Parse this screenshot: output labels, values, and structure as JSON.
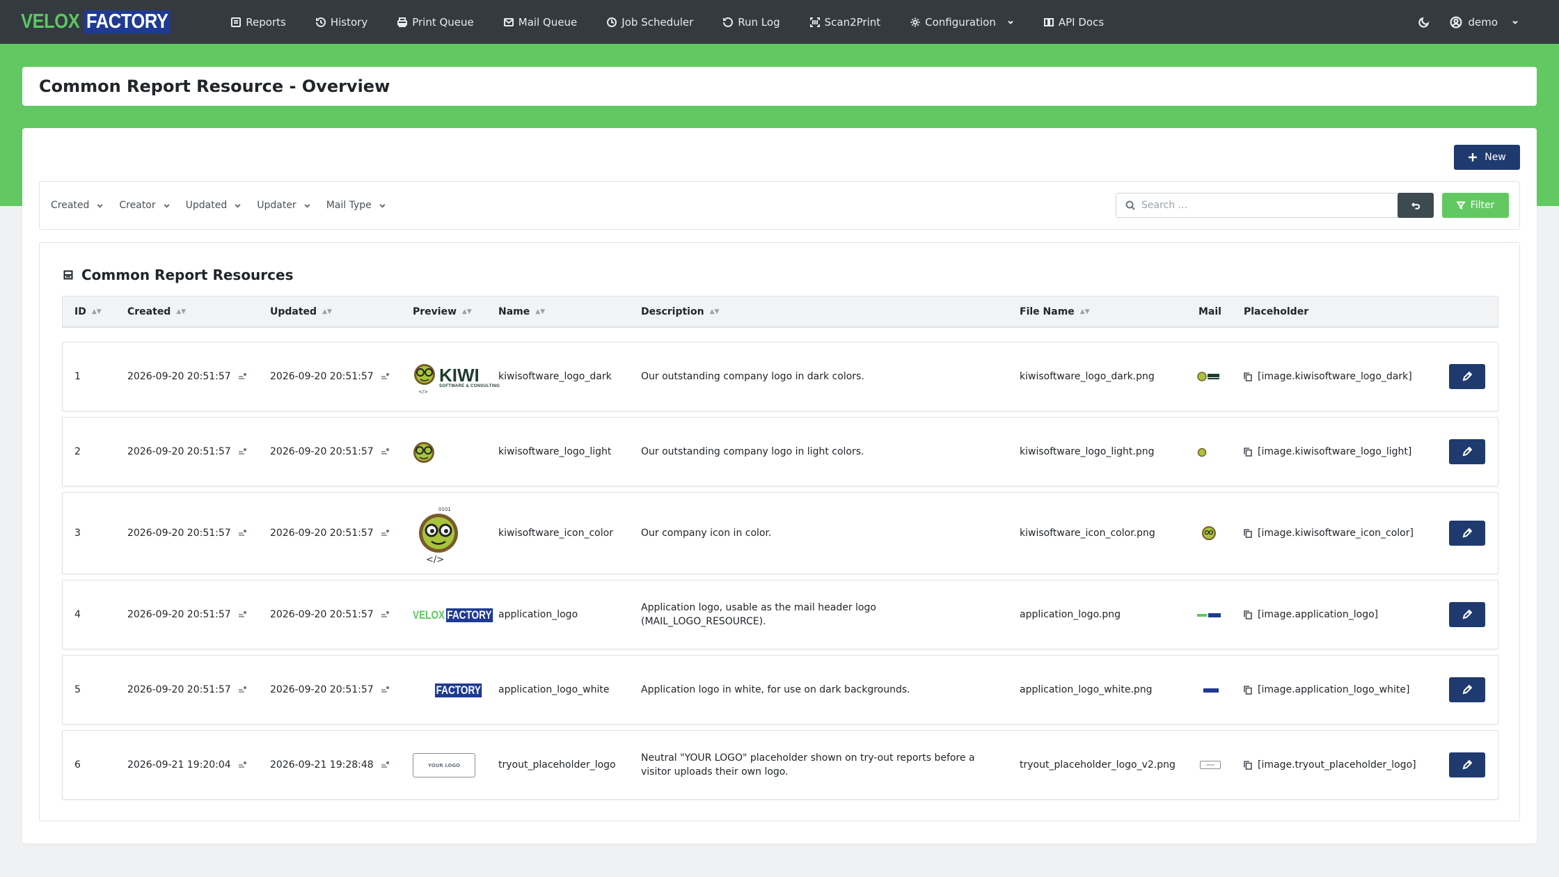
{
  "brand": {
    "part_a": "VELOX",
    "part_b": "FACTORY"
  },
  "nav": [
    {
      "label": "Reports",
      "icon": "reports-icon"
    },
    {
      "label": "History",
      "icon": "history-icon"
    },
    {
      "label": "Print Queue",
      "icon": "printer-icon"
    },
    {
      "label": "Mail Queue",
      "icon": "mail-icon"
    },
    {
      "label": "Job Scheduler",
      "icon": "clock-icon"
    },
    {
      "label": "Run Log",
      "icon": "run-log-icon"
    },
    {
      "label": "Scan2Print",
      "icon": "scan-icon"
    },
    {
      "label": "Configuration",
      "icon": "gear-icon"
    },
    {
      "label": "API Docs",
      "icon": "book-icon"
    }
  ],
  "user": {
    "name": "demo"
  },
  "page_title": "Common Report Resource - Overview",
  "toolbar": {
    "new_label": "New",
    "filter_label": "Filter"
  },
  "filters": [
    "Created",
    "Creator",
    "Updated",
    "Updater",
    "Mail Type"
  ],
  "search": {
    "placeholder": "Search ..."
  },
  "table": {
    "title": "Common Report Resources",
    "columns": [
      "ID",
      "Created",
      "Updated",
      "Preview",
      "Name",
      "Description",
      "File Name",
      "Mail",
      "Placeholder"
    ],
    "rows": [
      {
        "id": "1",
        "created": "2026-09-20 20:51:57",
        "updated": "2026-09-20 20:51:57",
        "name": "kiwisoftware_logo_dark",
        "description": "Our outstanding company logo in dark colors.",
        "file": "kiwisoftware_logo_dark.png",
        "placeholder": "[image.kiwisoftware_logo_dark]"
      },
      {
        "id": "2",
        "created": "2026-09-20 20:51:57",
        "updated": "2026-09-20 20:51:57",
        "name": "kiwisoftware_logo_light",
        "description": "Our outstanding company logo in light colors.",
        "file": "kiwisoftware_logo_light.png",
        "placeholder": "[image.kiwisoftware_logo_light]"
      },
      {
        "id": "3",
        "created": "2026-09-20 20:51:57",
        "updated": "2026-09-20 20:51:57",
        "name": "kiwisoftware_icon_color",
        "description": "Our company icon in color.",
        "file": "kiwisoftware_icon_color.png",
        "placeholder": "[image.kiwisoftware_icon_color]"
      },
      {
        "id": "4",
        "created": "2026-09-20 20:51:57",
        "updated": "2026-09-20 20:51:57",
        "name": "application_logo",
        "description": "Application logo, usable as the mail header logo (MAIL_LOGO_RESOURCE).",
        "file": "application_logo.png",
        "placeholder": "[image.application_logo]"
      },
      {
        "id": "5",
        "created": "2026-09-20 20:51:57",
        "updated": "2026-09-20 20:51:57",
        "name": "application_logo_white",
        "description": "Application logo in white, for use on dark backgrounds.",
        "file": "application_logo_white.png",
        "placeholder": "[image.application_logo_white]"
      },
      {
        "id": "6",
        "created": "2026-09-21 19:20:04",
        "updated": "2026-09-21 19:28:48",
        "name": "tryout_placeholder_logo",
        "description": "Neutral \"YOUR LOGO\" placeholder shown on try-out reports before a visitor uploads their own logo.",
        "file": "tryout_placeholder_logo_v2.png",
        "placeholder": "[image.tryout_placeholder_logo]"
      }
    ]
  },
  "previews": {
    "kiwi_word": "KIWI",
    "kiwi_sub": "SOFTWARE & CONSULTING",
    "your_logo": "YOUR LOGO"
  },
  "colors": {
    "navbar": "#343a40",
    "accent_green": "#62c962",
    "primary_navy": "#1f3a6e"
  }
}
